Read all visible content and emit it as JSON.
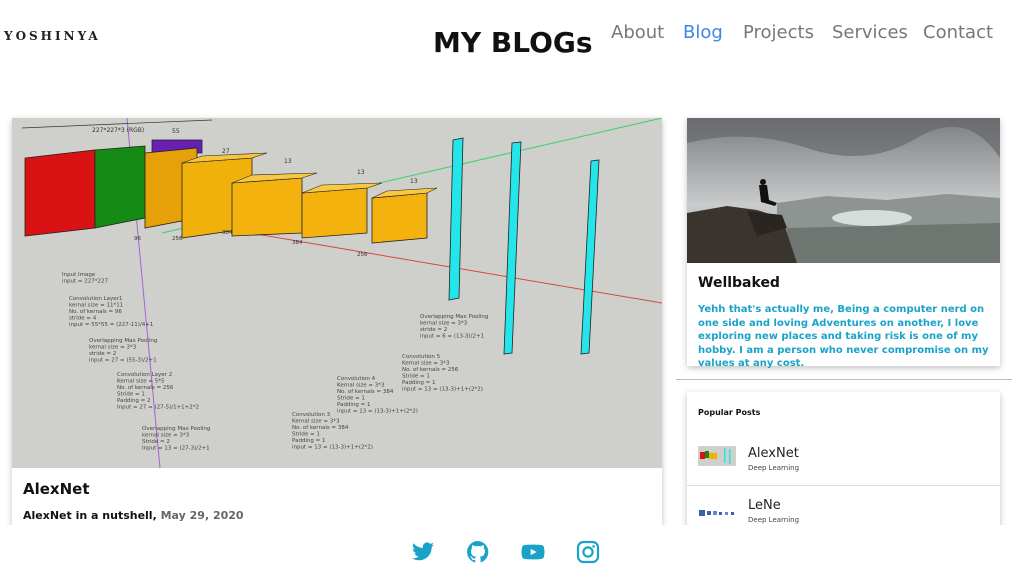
{
  "header": {
    "logo": "YOSHINYA",
    "title": "MY BLOGs",
    "nav": [
      "About",
      "Blog",
      "Projects",
      "Services",
      "Contact"
    ],
    "active_nav": "Blog"
  },
  "main_post": {
    "title": "AlexNet",
    "subtitle": "AlexNet in a nutshell,",
    "date": "May 29, 2020",
    "diagram_labels": {
      "top_dim": "227*227*3 (RGB)",
      "l1": "55",
      "l2": "27",
      "l3": "13",
      "l4": "13",
      "l5": "13",
      "input": "Input Image\ninput = 227*227",
      "conv1": "Convolution Layer1\nkernal size = 11*11\nNo. of kernals = 96\nstride = 4\ninput = 55*55 = (227-11)/4+1",
      "pool1": "Overlapping Max Pooling\nkernal size = 3*3\nstride = 2\ninput = 27 = (55-3)/2+1",
      "conv2": "Convolution Layer 2\nKernal size = 5*5\nNo. of kernals = 256\nStride = 1\nPadding = 2\nInput = 27 = (27-5)/1+1+2*2",
      "pool2": "Overlapping Max Pooling\nkernal size = 3*3\nStride = 2\nInput = 13 = (27-3)/2+1",
      "conv3": "Convolution 3\nKernal size = 3*3\nNo. of kernals = 384\nStride = 1\nPadding = 1\ninput = 13 = (13-3)+1+(2*2)",
      "conv4": "Convolution 4\nKernal size = 3*3\nNo. of kernals = 384\nStride = 1\nPadding = 1\ninput = 13 = (13-3)+1+(2*2)",
      "conv5": "Convolution 5\nKernal size = 3*3\nNo. of kernals = 256\nStride = 1\nPadding = 1\ninput = 13 = (13-3)+1+(2*2)",
      "pool3": "Overlapping Max Pooling\nkernal size = 3*3\nstride = 2\ninput = 6 = (13-3)/2+1",
      "d256": "256",
      "d384a": "384",
      "d384b": "384",
      "d256b": "256",
      "d96": "96"
    }
  },
  "profile": {
    "name": "Wellbaked",
    "bio": "Yehh that's actually me, Being a computer nerd on one side and loving Adventures on another, I love exploring new places and taking risk is one of my hobby. I am a person who never compromise on my values at any cost."
  },
  "popular": {
    "heading": "Popular Posts",
    "items": [
      {
        "title": "AlexNet",
        "category": "Deep Learning"
      },
      {
        "title": "LeNe",
        "category": "Deep Learning"
      }
    ]
  },
  "social": [
    "twitter-icon",
    "github-icon",
    "youtube-icon",
    "instagram-icon"
  ],
  "colors": {
    "accent": "#3b87e6",
    "bio": "#1aa3c8",
    "social": "#1aa3c8"
  }
}
